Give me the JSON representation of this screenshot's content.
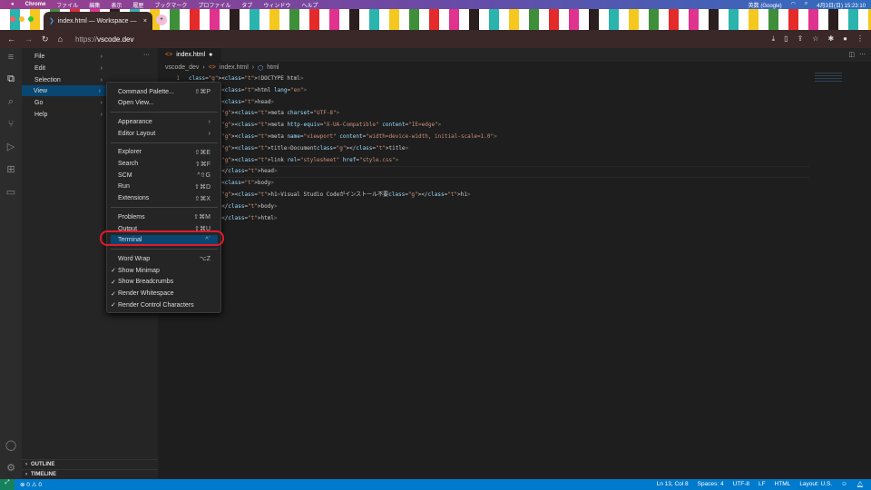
{
  "macos_menubar": {
    "apple": "",
    "app": "Chrome",
    "items": [
      "ファイル",
      "編集",
      "表示",
      "履歴",
      "ブックマーク",
      "プロファイル",
      "タブ",
      "ウィンドウ",
      "ヘルプ"
    ],
    "input_source": "英数 (Google)",
    "clock": "4月3日(日) 15:23:10"
  },
  "browser": {
    "tab_title": "index.html — Workspace —",
    "new_tab": "+",
    "url_scheme": "https://",
    "url_host": "vscode.dev"
  },
  "menu": {
    "items": [
      "File",
      "Edit",
      "Selection",
      "View",
      "Go",
      "Help"
    ],
    "selected": "View",
    "more": "···"
  },
  "view_submenu": [
    {
      "label": "Command Palette...",
      "key": "⇧⌘P"
    },
    {
      "label": "Open View...",
      "key": ""
    },
    {
      "label": "Appearance",
      "key": "›"
    },
    {
      "label": "Editor Layout",
      "key": "›"
    },
    {
      "label": "Explorer",
      "key": "⇧⌘E"
    },
    {
      "label": "Search",
      "key": "⇧⌘F"
    },
    {
      "label": "SCM",
      "key": "^⇧G"
    },
    {
      "label": "Run",
      "key": "⇧⌘D"
    },
    {
      "label": "Extensions",
      "key": "⇧⌘X"
    },
    {
      "label": "Problems",
      "key": "⇧⌘M"
    },
    {
      "label": "Output",
      "key": "⇧⌘U"
    },
    {
      "label": "Terminal",
      "key": "^`"
    },
    {
      "label": "Word Wrap",
      "key": "⌥Z"
    },
    {
      "label": "Show Minimap",
      "key": "",
      "checked": "✓"
    },
    {
      "label": "Show Breadcrumbs",
      "key": "",
      "checked": "✓"
    },
    {
      "label": "Render Whitespace",
      "key": "",
      "checked": "✓"
    },
    {
      "label": "Render Control Characters",
      "key": "",
      "checked": "✓"
    }
  ],
  "editor": {
    "tab": "index.html",
    "modified": "●",
    "breadcrumb": [
      "vscode_dev",
      "index.html",
      "html"
    ],
    "lines": [
      {
        "n": "1",
        "c": "<!DOCTYPE html>"
      },
      {
        "n": "2",
        "c": "<html lang=\"en\">"
      },
      {
        "n": "3",
        "c": "<head>"
      },
      {
        "n": "4",
        "c": "    <meta charset=\"UTF-8\">"
      },
      {
        "n": "5",
        "c": "    <meta http-equiv=\"X-UA-Compatible\" content=\"IE=edge\">"
      },
      {
        "n": "6",
        "c": "    <meta name=\"viewport\" content=\"width=device-width, initial-scale=1.0\">"
      },
      {
        "n": "7",
        "c": "    <title>Document</title>"
      },
      {
        "n": "8",
        "c": "    <link rel=\"stylesheet\" href=\"style.css\">"
      },
      {
        "n": "9",
        "c": "</head>"
      },
      {
        "n": "10",
        "c": "<body>"
      },
      {
        "n": "11",
        "c": "    <h1>Visual Studio Codeがインストール不要</h1>"
      },
      {
        "n": "12",
        "c": "</body>"
      },
      {
        "n": "13",
        "c": "</html>"
      }
    ]
  },
  "panels": {
    "outline": "OUTLINE",
    "timeline": "TIMELINE"
  },
  "status": {
    "errors": "0",
    "warnings": "0",
    "position": "Ln 13, Col 8",
    "spaces": "Spaces: 4",
    "encoding": "UTF-8",
    "eol": "LF",
    "language": "HTML",
    "layout": "Layout: U.S."
  },
  "colors": {
    "statusbar": "#007acc",
    "highlight": "#094771",
    "annotation": "#e01b2b"
  }
}
